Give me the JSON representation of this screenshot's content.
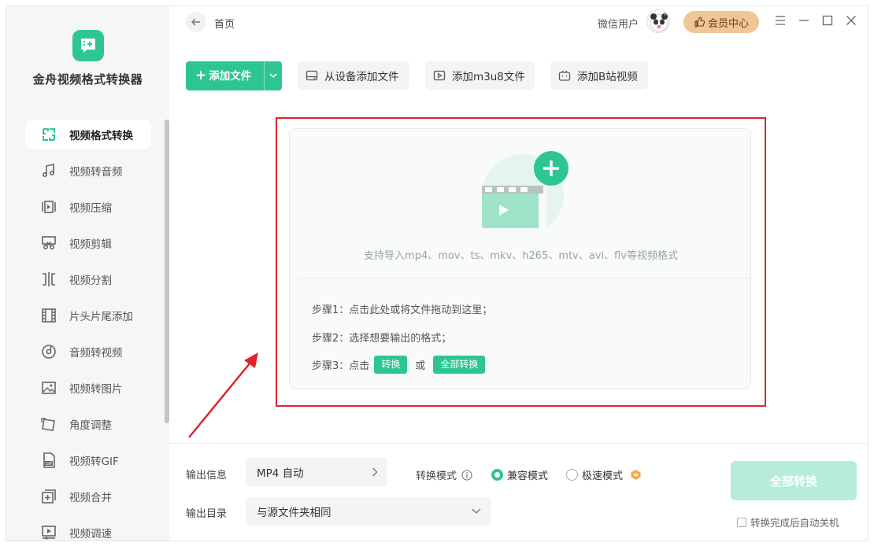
{
  "app": {
    "name": "金舟视频格式转换器"
  },
  "header": {
    "breadcrumb": "首页",
    "user_name": "微信用户",
    "vip_label": "会员中心"
  },
  "sidebar": {
    "items": [
      {
        "label": "视频格式转换",
        "icon": "convert-icon",
        "active": true
      },
      {
        "label": "视频转音频",
        "icon": "music-note-icon"
      },
      {
        "label": "视频压缩",
        "icon": "compress-icon"
      },
      {
        "label": "视频剪辑",
        "icon": "scissors-icon"
      },
      {
        "label": "视频分割",
        "icon": "split-icon"
      },
      {
        "label": "片头片尾添加",
        "icon": "film-strip-icon"
      },
      {
        "label": "音频转视频",
        "icon": "disc-icon"
      },
      {
        "label": "视频转图片",
        "icon": "image-icon"
      },
      {
        "label": "角度调整",
        "icon": "rotate-icon"
      },
      {
        "label": "视频转GIF",
        "icon": "gif-icon"
      },
      {
        "label": "视频合并",
        "icon": "merge-icon"
      },
      {
        "label": "视频调速",
        "icon": "speed-icon"
      }
    ]
  },
  "toolbar": {
    "add_file": "添加文件",
    "add_from_device": "从设备添加文件",
    "add_m3u8": "添加m3u8文件",
    "add_bilibili": "添加B站视频"
  },
  "dropzone": {
    "support_text": "支持导入mp4、mov、ts、mkv、h265、mtv、avi、flv等视频格式",
    "step1": "步骤1：点击此处或将文件拖动到这里；",
    "step2": "步骤2：选择想要输出的格式；",
    "step3_prefix": "步骤3：点击",
    "step3_convert": "转换",
    "step3_or": "或",
    "step3_convert_all": "全部转换"
  },
  "bottom": {
    "output_info_label": "输出信息",
    "output_format": "MP4 自动",
    "output_dir_label": "输出目录",
    "output_dir": "与源文件夹相同",
    "mode_label": "转换模式",
    "mode_compatible": "兼容模式",
    "mode_fast": "极速模式",
    "selected_mode": "兼容模式",
    "convert_all": "全部转换",
    "auto_shutdown": "转换完成后自动关机",
    "auto_shutdown_checked": false
  },
  "colors": {
    "accent": "#2ec690",
    "highlight_frame": "#e0232b",
    "vip": "#efc697"
  }
}
